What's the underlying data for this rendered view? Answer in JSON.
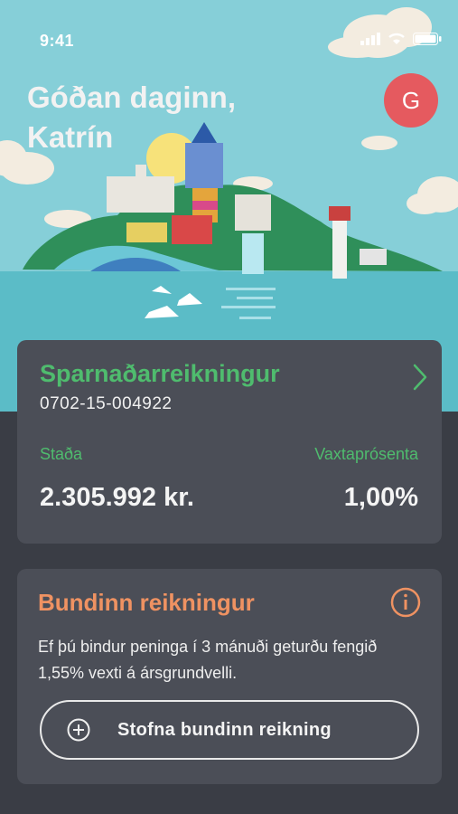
{
  "status": {
    "time": "9:41"
  },
  "header": {
    "greeting_line1": "Góðan daginn,",
    "greeting_line2": "Katrín",
    "avatar_letter": "G"
  },
  "savings": {
    "name": "Sparnaðarreikningur",
    "number": "0702-15-004922",
    "balance_label": "Staða",
    "balance_value": "2.305.992 kr.",
    "rate_label": "Vaxtaprósenta",
    "rate_value": "1,00%"
  },
  "fixed": {
    "title": "Bundinn reikningur",
    "description": "Ef þú bindur peninga í 3 mánuði geturðu fengið 1,55% vexti á ársgrundvelli.",
    "button_label": "Stofna bundinn reikning"
  },
  "colors": {
    "accent_green": "#4fbc6e",
    "accent_orange": "#ef9262",
    "avatar": "#e55a5f",
    "card": "#4b4e57",
    "background": "#3a3d45"
  }
}
